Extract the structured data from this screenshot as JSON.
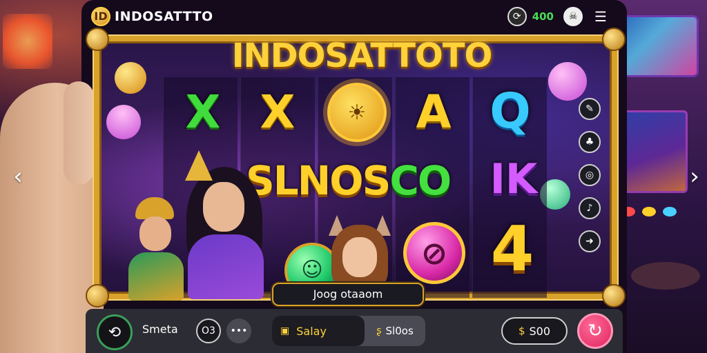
{
  "header": {
    "brand_icon": "ID",
    "brand_name": "INDOSATTTO",
    "balance": "400",
    "icons": [
      "speed-icon",
      "skull-icon",
      "menu-icon"
    ]
  },
  "game": {
    "title": "INDOSATTOTO",
    "reel_top": [
      "X",
      "X",
      "☀",
      "A",
      "Q"
    ],
    "word_main": "SLNOS",
    "word_main_green": "CO",
    "word_ik": "IK",
    "symbol_4": "4",
    "join_button": "Joog otaaom"
  },
  "rail": [
    "pen-icon",
    "tree-icon",
    "settings-icon",
    "bell-icon",
    "arrow-right-icon"
  ],
  "bottom_bar": {
    "label": "Smeta",
    "circle_1": "O3",
    "circle_2": "•••",
    "split_left": "Salay",
    "split_right": "Sl0os",
    "bet": "S00"
  },
  "colors": {
    "gold": "#d9a22a",
    "balance_green": "#4bdc53",
    "spin_pink": "#e0245e"
  }
}
